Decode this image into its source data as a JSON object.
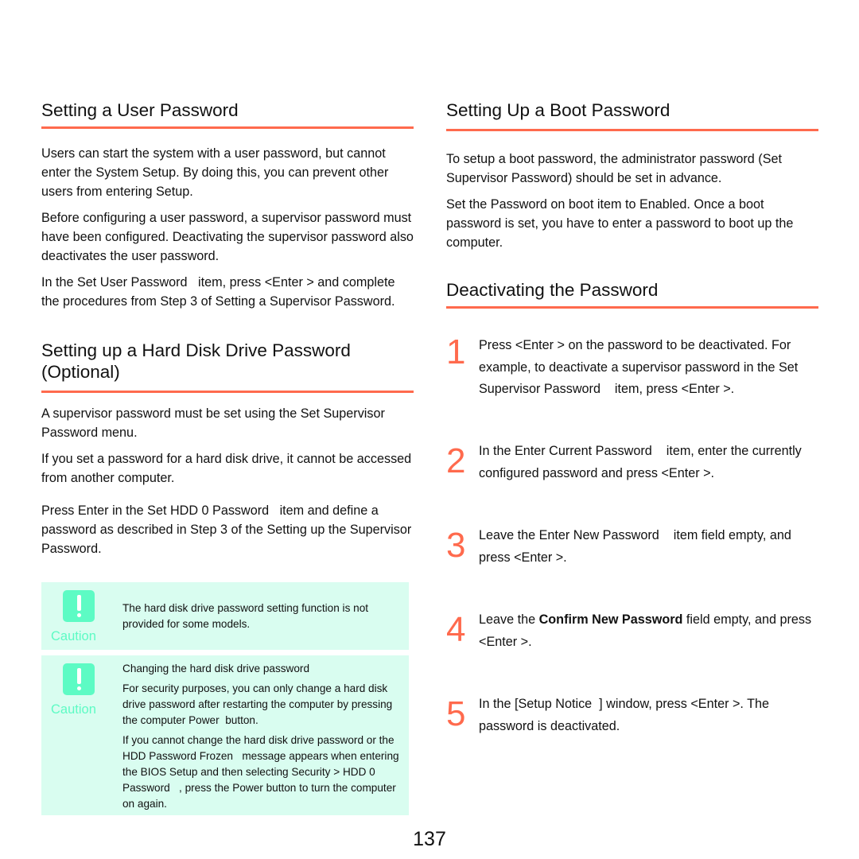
{
  "left": {
    "user_password": {
      "heading": "Setting a User Password",
      "paragraphs": [
        "Users can start the system with a user password, but cannot enter the System Setup. By doing this, you can prevent other users from entering Setup.",
        "Before configuring a user password, a supervisor password must have been configured. Deactivating the supervisor password also deactivates the user password.",
        "In the Set User Password   item, press <Enter > and complete the procedures from Step 3 of Setting a Supervisor Password."
      ]
    },
    "hdd_password": {
      "heading": "Setting up a Hard Disk Drive Password (Optional)",
      "paragraphs": [
        "A supervisor password must be set using the Set Supervisor Password menu.",
        "If you set a password for a hard disk drive, it cannot be accessed from another computer.",
        "Press Enter in the Set HDD 0 Password   item and define a password as described in Step 3 of the Setting up the Supervisor Password."
      ]
    },
    "cautions": [
      {
        "label": "Caution",
        "icon": "exclamation-icon",
        "paragraphs": [
          "The hard disk drive password setting function is not provided for some models."
        ]
      },
      {
        "label": "Caution",
        "icon": "exclamation-icon",
        "paragraphs": [
          "Changing the hard disk drive password",
          "For security purposes, you can only change a hard disk drive password after restarting the computer by pressing the computer Power  button.",
          "If you cannot change the hard disk drive password or the HDD Password Frozen   message appears when entering the BIOS Setup and then selecting Security > HDD 0 Password   , press the Power button to turn the computer on again."
        ]
      }
    ]
  },
  "right": {
    "boot_password": {
      "heading": "Setting Up a Boot Password",
      "paragraphs": [
        "To setup a boot password, the administrator password (Set Supervisor Password) should be set in advance.",
        "Set the Password on boot item to Enabled. Once a boot password is set, you have to enter a password to boot up the computer."
      ]
    },
    "deactivating": {
      "heading": "Deactivating the Password",
      "steps": [
        {
          "number": "1",
          "text": "Press <Enter > on the password to be deactivated. For example, to deactivate a supervisor password in the Set Supervisor Password    item, press <Enter >."
        },
        {
          "number": "2",
          "text": "In the Enter Current Password    item, enter the currently configured password and press <Enter >."
        },
        {
          "number": "3",
          "text": "Leave the Enter New Password    item field empty, and press <Enter >."
        },
        {
          "number": "4",
          "text_before": "Leave the ",
          "text_bold": "Confirm New Password",
          "text_after": " field empty, and press <Enter >."
        },
        {
          "number": "5",
          "text": "In the [Setup Notice  ] window, press <Enter >. The password is deactivated."
        }
      ]
    }
  },
  "page_number": "137",
  "colors": {
    "accent": "#ff6a4d",
    "caution_bg": "#d9fdf0",
    "caution_icon": "#5dfbc4"
  }
}
